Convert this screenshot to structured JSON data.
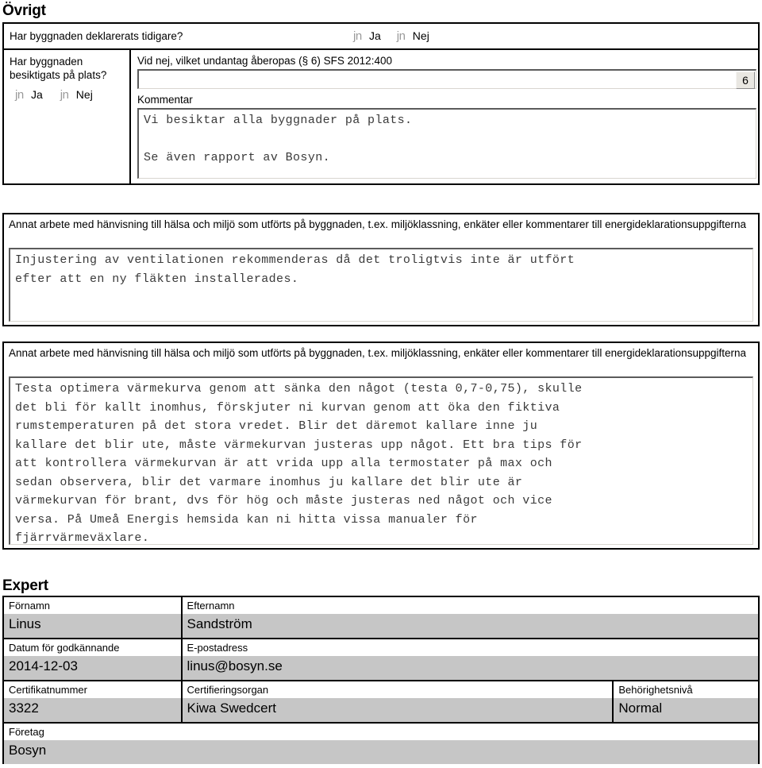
{
  "sections": {
    "ovrigt": {
      "heading": "Övrigt",
      "declared": {
        "label": "Har byggnaden deklarerats tidigare?",
        "options": [
          {
            "glyph": "jn",
            "label": "Ja"
          },
          {
            "glyph": "jn",
            "label": "Nej"
          }
        ]
      },
      "inspected": {
        "label": "Har byggnaden besiktigats på plats?",
        "options": [
          {
            "glyph": "jn",
            "label": "Ja"
          },
          {
            "glyph": "jn",
            "label": "Nej"
          }
        ]
      },
      "exemption": {
        "label": "Vid nej, vilket undantag åberopas (§ 6) SFS 2012:400",
        "value": "",
        "dropdown_glyph": "6"
      },
      "comment": {
        "label": "Kommentar",
        "value": "Vi besiktar alla byggnader på plats.\n\nSe även rapport av Bosyn."
      }
    },
    "annat_arbete_1": {
      "label": "Annat arbete med hänvisning till hälsa och miljö som utförts på byggnaden, t.ex. miljöklassning, enkäter eller kommentarer till energideklarationsuppgifterna",
      "value": "Injustering av ventilationen rekommenderas då det troligtvis inte är utfört\nefter att en ny fläkten installerades."
    },
    "annat_arbete_2": {
      "label": "Annat arbete med hänvisning till hälsa och miljö som utförts på byggnaden, t.ex. miljöklassning, enkäter eller kommentarer till energideklarationsuppgifterna",
      "value": "Testa optimera värmekurva genom att sänka den något (testa 0,7-0,75), skulle\ndet bli för kallt inomhus, förskjuter ni kurvan genom att öka den fiktiva\nrumstemperaturen på det stora vredet. Blir det däremot kallare inne ju\nkallare det blir ute, måste värmekurvan justeras upp något. Ett bra tips för\natt kontrollera värmekurvan är att vrida upp alla termostater på max och\nsedan observera, blir det varmare inomhus ju kallare det blir ute är\nvärmekurvan för brant, dvs för hög och måste justeras ned något och vice\nversa. På Umeå Energis hemsida kan ni hitta vissa manualer för\nfjärrvärmeväxlare."
    },
    "expert": {
      "heading": "Expert",
      "fields": {
        "firstname_label": "Förnamn",
        "firstname_value": "Linus",
        "lastname_label": "Efternamn",
        "lastname_value": "Sandström",
        "approval_date_label": "Datum för godkännande",
        "approval_date_value": "2014-12-03",
        "email_label": "E-postadress",
        "email_value": "linus@bosyn.se",
        "certificate_number_label": "Certifikatnummer",
        "certificate_number_value": "3322",
        "certification_body_label": "Certifieringsorgan",
        "certification_body_value": "Kiwa Swedcert",
        "authorization_level_label": "Behörighetsnivå",
        "authorization_level_value": "Normal",
        "company_label": "Företag",
        "company_value": "Bosyn"
      }
    }
  },
  "colors": {
    "value_background": "#c6c6c6",
    "border": "#000000",
    "mono_text": "#3a3a3a"
  }
}
